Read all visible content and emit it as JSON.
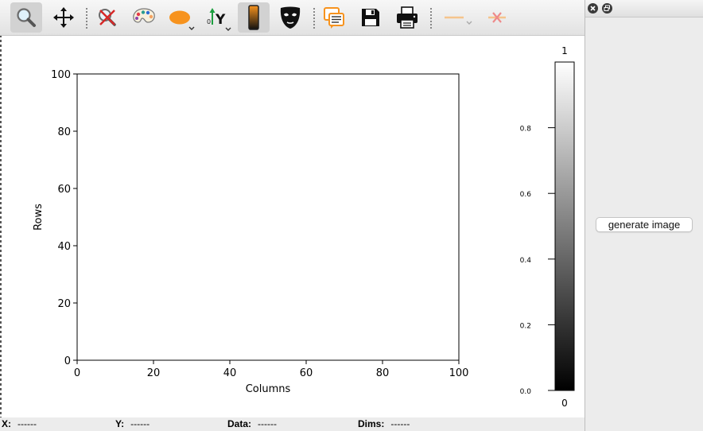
{
  "toolbar": {
    "tools": [
      {
        "name": "zoom",
        "icon": "magnifier-icon",
        "active": true
      },
      {
        "name": "pan",
        "icon": "move-arrows-icon"
      },
      {
        "name": "reset-zoom",
        "icon": "reset-zoom-icon"
      },
      {
        "name": "colormap",
        "icon": "palette-icon"
      },
      {
        "name": "aspect",
        "icon": "ellipse-icon",
        "has_menu": true
      },
      {
        "name": "y-axis",
        "icon": "y-axis-origin-icon",
        "has_menu": true
      },
      {
        "name": "colorbar",
        "icon": "colorbar-icon",
        "active": true
      },
      {
        "name": "mask",
        "icon": "mask-icon"
      },
      {
        "name": "copy",
        "icon": "copy-icon"
      },
      {
        "name": "save",
        "icon": "floppy-icon"
      },
      {
        "name": "print",
        "icon": "printer-icon"
      },
      {
        "name": "crosshair",
        "icon": "crosshair-line-icon",
        "disabled": true,
        "has_menu": true
      },
      {
        "name": "remove-crosshair",
        "icon": "crosshair-remove-icon",
        "disabled": true
      }
    ]
  },
  "chart_data": [
    {
      "type": "heatmap",
      "title": "",
      "xlabel": "Columns",
      "ylabel": "Rows",
      "xlim": [
        0,
        100
      ],
      "ylim": [
        0,
        100
      ],
      "xticks": [
        0,
        20,
        40,
        60,
        80,
        100
      ],
      "yticks": [
        0,
        20,
        40,
        60,
        80,
        100
      ],
      "values": []
    },
    {
      "type": "colorbar",
      "colormap": "gray",
      "vmin": 0,
      "vmax": 1,
      "vmin_label": "0",
      "vmax_label": "1",
      "ticks": [
        "0.0",
        "0.2",
        "0.4",
        "0.6",
        "0.8"
      ]
    }
  ],
  "status": {
    "x_label": "X:",
    "x_value": "------",
    "y_label": "Y:",
    "y_value": "------",
    "data_label": "Data:",
    "data_value": "------",
    "dims_label": "Dims:",
    "dims_value": "------"
  },
  "panel": {
    "close_icon": "close-icon",
    "float_icon": "float-icon",
    "generate_label": "generate image"
  }
}
